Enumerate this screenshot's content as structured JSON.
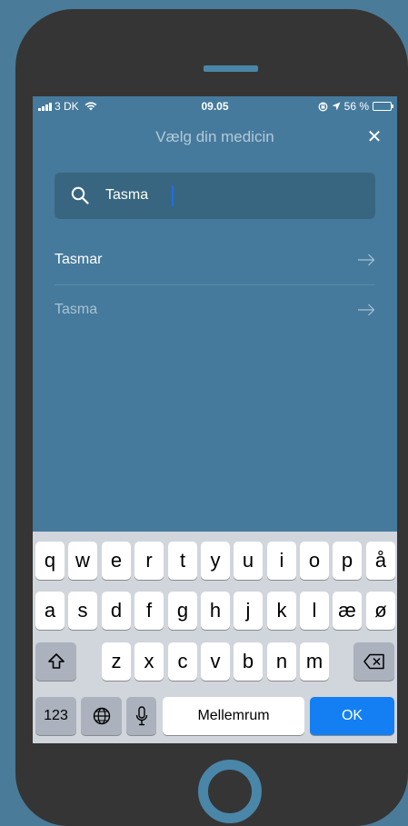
{
  "status_bar": {
    "carrier": "3 DK",
    "time": "09.05",
    "battery": "56 %",
    "battery_level": 0.56
  },
  "header": {
    "title": "Vælg din medicin",
    "close_icon": "close-icon"
  },
  "search": {
    "value": "Tasma",
    "icon": "search-icon"
  },
  "results": [
    {
      "label": "Tasmar"
    },
    {
      "label": "Tasma"
    }
  ],
  "keyboard": {
    "row1": [
      "q",
      "w",
      "e",
      "r",
      "t",
      "y",
      "u",
      "i",
      "o",
      "p",
      "å"
    ],
    "row2": [
      "a",
      "s",
      "d",
      "f",
      "g",
      "h",
      "j",
      "k",
      "l",
      "æ",
      "ø"
    ],
    "row3": [
      "z",
      "x",
      "c",
      "v",
      "b",
      "n",
      "m"
    ],
    "numbers_label": "123",
    "space_label": "Mellemrum",
    "return_label": "OK"
  },
  "colors": {
    "background": "#4a7c99",
    "screen": "#457a9c",
    "search_field": "#386680",
    "accent": "#137ff3",
    "battery": "#f5d312"
  }
}
